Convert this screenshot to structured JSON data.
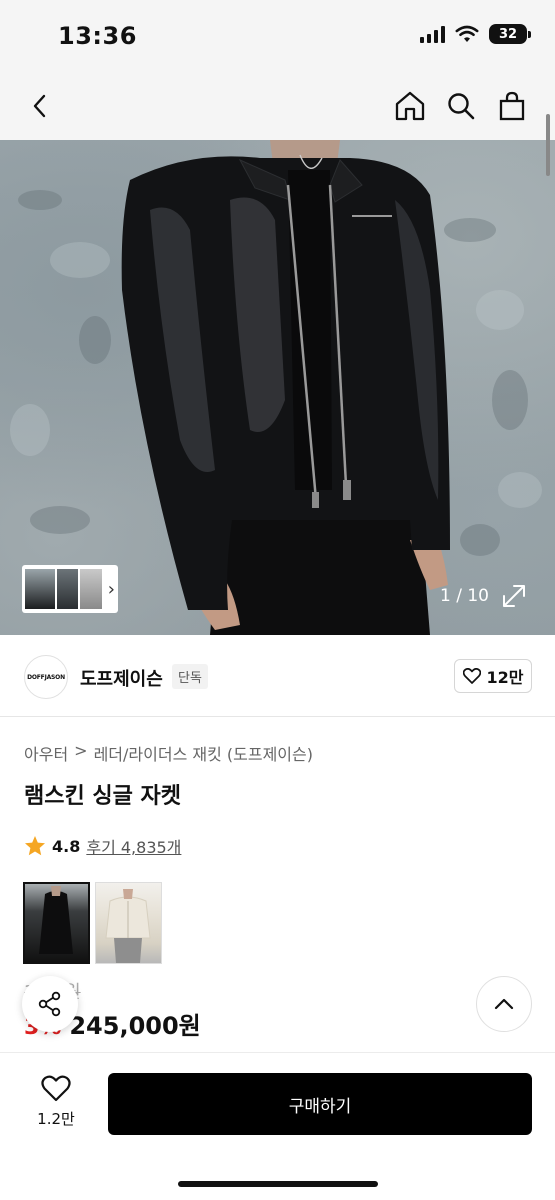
{
  "status_bar": {
    "time": "13:36",
    "battery": "32"
  },
  "nav": {
    "back_icon": "chevron-left-icon",
    "home_icon": "home-icon",
    "search_icon": "search-icon",
    "cart_icon": "shopping-bag-icon"
  },
  "gallery": {
    "counter": "1 / 10",
    "expand_icon": "expand-icon"
  },
  "brand": {
    "logo_text": "DOFFJASON",
    "name": "도프제이슨",
    "tag": "단독",
    "like_count": "12만"
  },
  "breadcrumb": [
    "아우터",
    ">",
    "레더/라이더스 재킷 (도프제이슨)"
  ],
  "product": {
    "title": "램스킨 싱글 자켓",
    "rating": "4.8",
    "reviews": "후기 4,835개",
    "original_price": "3 90원",
    "discount": "3%",
    "price": "245,000원"
  },
  "variants": [
    {
      "color": "black",
      "selected": true
    },
    {
      "color": "cream",
      "selected": false
    }
  ],
  "bottom": {
    "wish_count": "1.2만",
    "buy_label": "구매하기"
  },
  "colors": {
    "accent_red": "#e02020",
    "buy_button": "#000000",
    "star": "#f5a623"
  }
}
